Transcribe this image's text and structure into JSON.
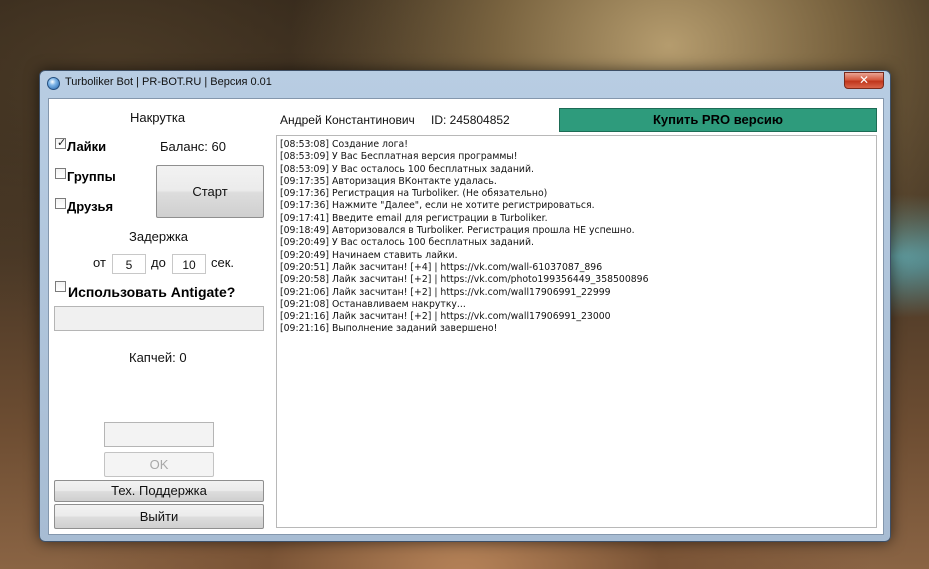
{
  "window": {
    "title": "Turboliker Bot | PR-BOT.RU | Версия 0.01",
    "close_glyph": "✕"
  },
  "left": {
    "section_title": "Накрутка",
    "checkboxes": [
      {
        "label": "Лайки",
        "checked": true
      },
      {
        "label": "Группы",
        "checked": false
      },
      {
        "label": "Друзья",
        "checked": false
      }
    ],
    "balance": "Баланс: 60",
    "start_button": "Старт",
    "delay_title": "Задержка",
    "delay_from_label": "от",
    "delay_from": "5",
    "delay_to_label": "до",
    "delay_to": "10",
    "delay_unit": "сек.",
    "antigate_label": "Использовать Antigate?",
    "antigate_checked": false,
    "antigate_key": "",
    "captcha_count": "Капчей: 0",
    "captcha_input": "",
    "ok_button": "OK",
    "support_button": "Тех. Поддержка",
    "exit_button": "Выйти"
  },
  "header": {
    "user_name": "Андрей Константинович",
    "user_id": "ID: 245804852",
    "buy_pro": "Купить PRO версию",
    "buy_pro_color": "#2e9b7c"
  },
  "log": [
    "[08:53:08] Создание лога!",
    "[08:53:09] У Вас Бесплатная версия программы!",
    "[08:53:09] У Вас осталось 100 бесплатных заданий.",
    "[09:17:35] Авторизация ВКонтакте удалась.",
    "[09:17:36] Регистрация на Turboliker. (Не обязательно)",
    "[09:17:36] Нажмите \"Далее\", если не хотите регистрироваться.",
    "[09:17:41] Введите email для регистрации в Turboliker.",
    "[09:18:49] Авторизовался в Turboliker. Регистрация прошла НЕ успешно.",
    "[09:20:49] У Вас осталось 100 бесплатных заданий.",
    "[09:20:49] Начинаем ставить лайки.",
    "[09:20:51] Лайк засчитан! [+4] | https://vk.com/wall-61037087_896",
    "[09:20:58] Лайк засчитан! [+2] | https://vk.com/photo199356449_358500896",
    "[09:21:06] Лайк засчитан! [+2] | https://vk.com/wall17906991_22999",
    "[09:21:08] Останавливаем накрутку...",
    "[09:21:16] Лайк засчитан! [+2] | https://vk.com/wall17906991_23000",
    "[09:21:16] Выполнение заданий завершено!"
  ]
}
